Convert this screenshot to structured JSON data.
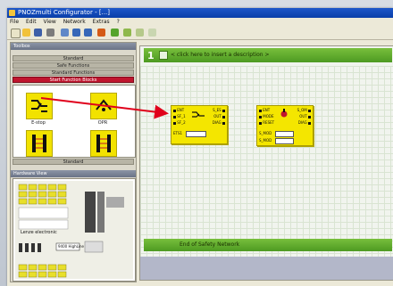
{
  "window": {
    "title": "PNOZmulti Configurator - [...]"
  },
  "menu": [
    "File",
    "Edit",
    "View",
    "Network",
    "Extras",
    "?"
  ],
  "toolbox": {
    "title": "Toolbox",
    "categories": [
      "Standard",
      "Safe Functions",
      "Standard Functions",
      "Start Function Blocks"
    ],
    "selected_index": 3,
    "icons": [
      {
        "label": "E-stop",
        "icon": "estop-contact-icon"
      },
      {
        "label": "OPR",
        "icon": "operating-mode-icon"
      },
      {
        "label": "",
        "icon": "light-barrier-icon"
      },
      {
        "label": "",
        "icon": "light-barrier-icon"
      }
    ],
    "footer": "Standard"
  },
  "hardware": {
    "title": "Hardware View",
    "brand": "Lenze electronic",
    "device_id": "9400 HighLine"
  },
  "network": {
    "number": "1",
    "description_prompt": "< click here to insert a description >",
    "end_label": "End of Safety Network"
  },
  "blocks": [
    {
      "name": "estop-block",
      "inputs": [
        "ENT",
        "SF_1",
        "SF_2"
      ],
      "outputs": [
        "S_ES",
        "OUT",
        "DIAG"
      ],
      "param": "ETS1"
    },
    {
      "name": "operating-mode-block",
      "inputs": [
        "ENT",
        "MODE",
        "RESET"
      ],
      "outputs": [
        "S_OM",
        "OUT",
        "DIAG"
      ],
      "params": [
        "S_MOD",
        "S_MOD"
      ]
    }
  ],
  "colors": {
    "accent_network": "#5aa82a",
    "block_yellow": "#f4e600",
    "selection_red": "#c0152e",
    "arrow": "#e0001b"
  }
}
